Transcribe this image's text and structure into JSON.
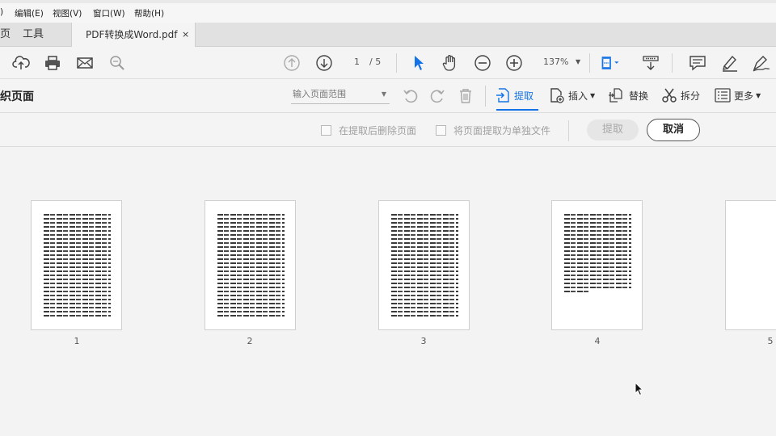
{
  "menu": {
    "items": [
      ")",
      "编辑(E)",
      "视图(V)",
      "窗口(W)",
      "帮助(H)"
    ]
  },
  "tabs": {
    "home_fragment": "页",
    "tools": "工具",
    "document": "PDF转换成Word.pdf",
    "close": "×"
  },
  "toolbar": {
    "current_page": "1",
    "total_pages": "/ 5",
    "zoom": "137%",
    "icons": [
      "upload-icon",
      "print-icon",
      "mail-icon",
      "search-icon",
      "prev-page-icon",
      "next-page-icon",
      "select-arrow-icon",
      "hand-icon",
      "zoom-out-icon",
      "zoom-in-icon",
      "fit-page-icon",
      "scroll-mode-icon",
      "comment-icon",
      "highlight-icon",
      "sign-icon"
    ]
  },
  "organize": {
    "title": "织页面",
    "range_placeholder": "输入页面范围",
    "extract": "提取",
    "insert": "插入",
    "replace": "替换",
    "split": "拆分",
    "more": "更多"
  },
  "extract_options": {
    "delete_after_extract": "在提取后删除页面",
    "extract_as_separate": "将页面提取为单独文件",
    "extract_button": "提取",
    "cancel_button": "取消"
  },
  "pages": {
    "labels": [
      "1",
      "2",
      "3",
      "4",
      "5"
    ]
  },
  "colors": {
    "accent": "#1473e6"
  }
}
